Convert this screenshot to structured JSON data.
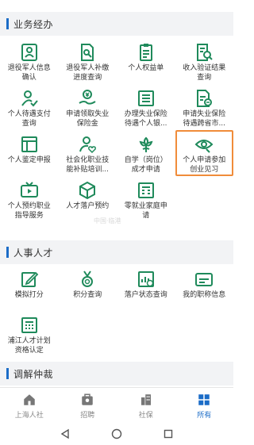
{
  "sections": [
    {
      "title": "业务经办",
      "rows": [
        [
          {
            "label": "退役军人信息\n确认",
            "icon": "id-card-icon"
          },
          {
            "label": "退役军人补缴\n进度查询",
            "icon": "document-search-icon"
          },
          {
            "label": "个人权益单",
            "icon": "clipboard-icon"
          },
          {
            "label": "收入验证结果\n查询",
            "icon": "search-document-icon"
          }
        ],
        [
          {
            "label": "个人待遇支付\n查询",
            "icon": "person-check-icon"
          },
          {
            "label": "申请领取失业\n保险金",
            "icon": "money-hand-icon"
          },
          {
            "label": "办理失业保险\n待遇个人银...",
            "icon": "form-list-icon"
          },
          {
            "label": "申请失业保险\n待遇跨省市...",
            "icon": "transfer-document-icon"
          }
        ],
        [
          {
            "label": "个人鉴定申报",
            "icon": "layout-icon"
          },
          {
            "label": "社会化职业技\n能补贴培训...",
            "icon": "person-heart-icon"
          },
          {
            "label": "自学（岗位）\n成才申请",
            "icon": "flower-icon"
          },
          {
            "label": "个人申请参加\n创业见习",
            "icon": "eye-icon",
            "highlighted": true
          }
        ],
        [
          {
            "label": "个人预约职业\n指导服务",
            "icon": "tv-icon"
          },
          {
            "label": "人才落户预约",
            "icon": "cube-icon"
          },
          {
            "label": "零就业家庭申\n请",
            "icon": "grid-form-icon"
          }
        ]
      ]
    },
    {
      "title": "人事人才",
      "rows": [
        [
          {
            "label": "模拟打分",
            "icon": "edit-icon"
          },
          {
            "label": "积分查询",
            "icon": "medal-icon"
          },
          {
            "label": "落户状态查询",
            "icon": "chart-document-icon"
          },
          {
            "label": "我的职称信息",
            "icon": "card-icon"
          }
        ],
        [
          {
            "label": "浦江人才计划\n资格认定",
            "icon": "calculator-icon"
          }
        ]
      ]
    },
    {
      "title": "调解仲裁",
      "rows": []
    }
  ],
  "watermark": "中国·临港",
  "tabs": [
    {
      "label": "上海人社",
      "icon": "home-icon",
      "active": false
    },
    {
      "label": "招聘",
      "icon": "briefcase-icon",
      "active": false
    },
    {
      "label": "社保",
      "icon": "building-icon",
      "active": false
    },
    {
      "label": "所有",
      "icon": "grid-icon",
      "active": true
    }
  ],
  "colors": {
    "accent": "#1b6cc7",
    "highlight": "#f08c3a",
    "icon_green": "#1f8a5b"
  }
}
